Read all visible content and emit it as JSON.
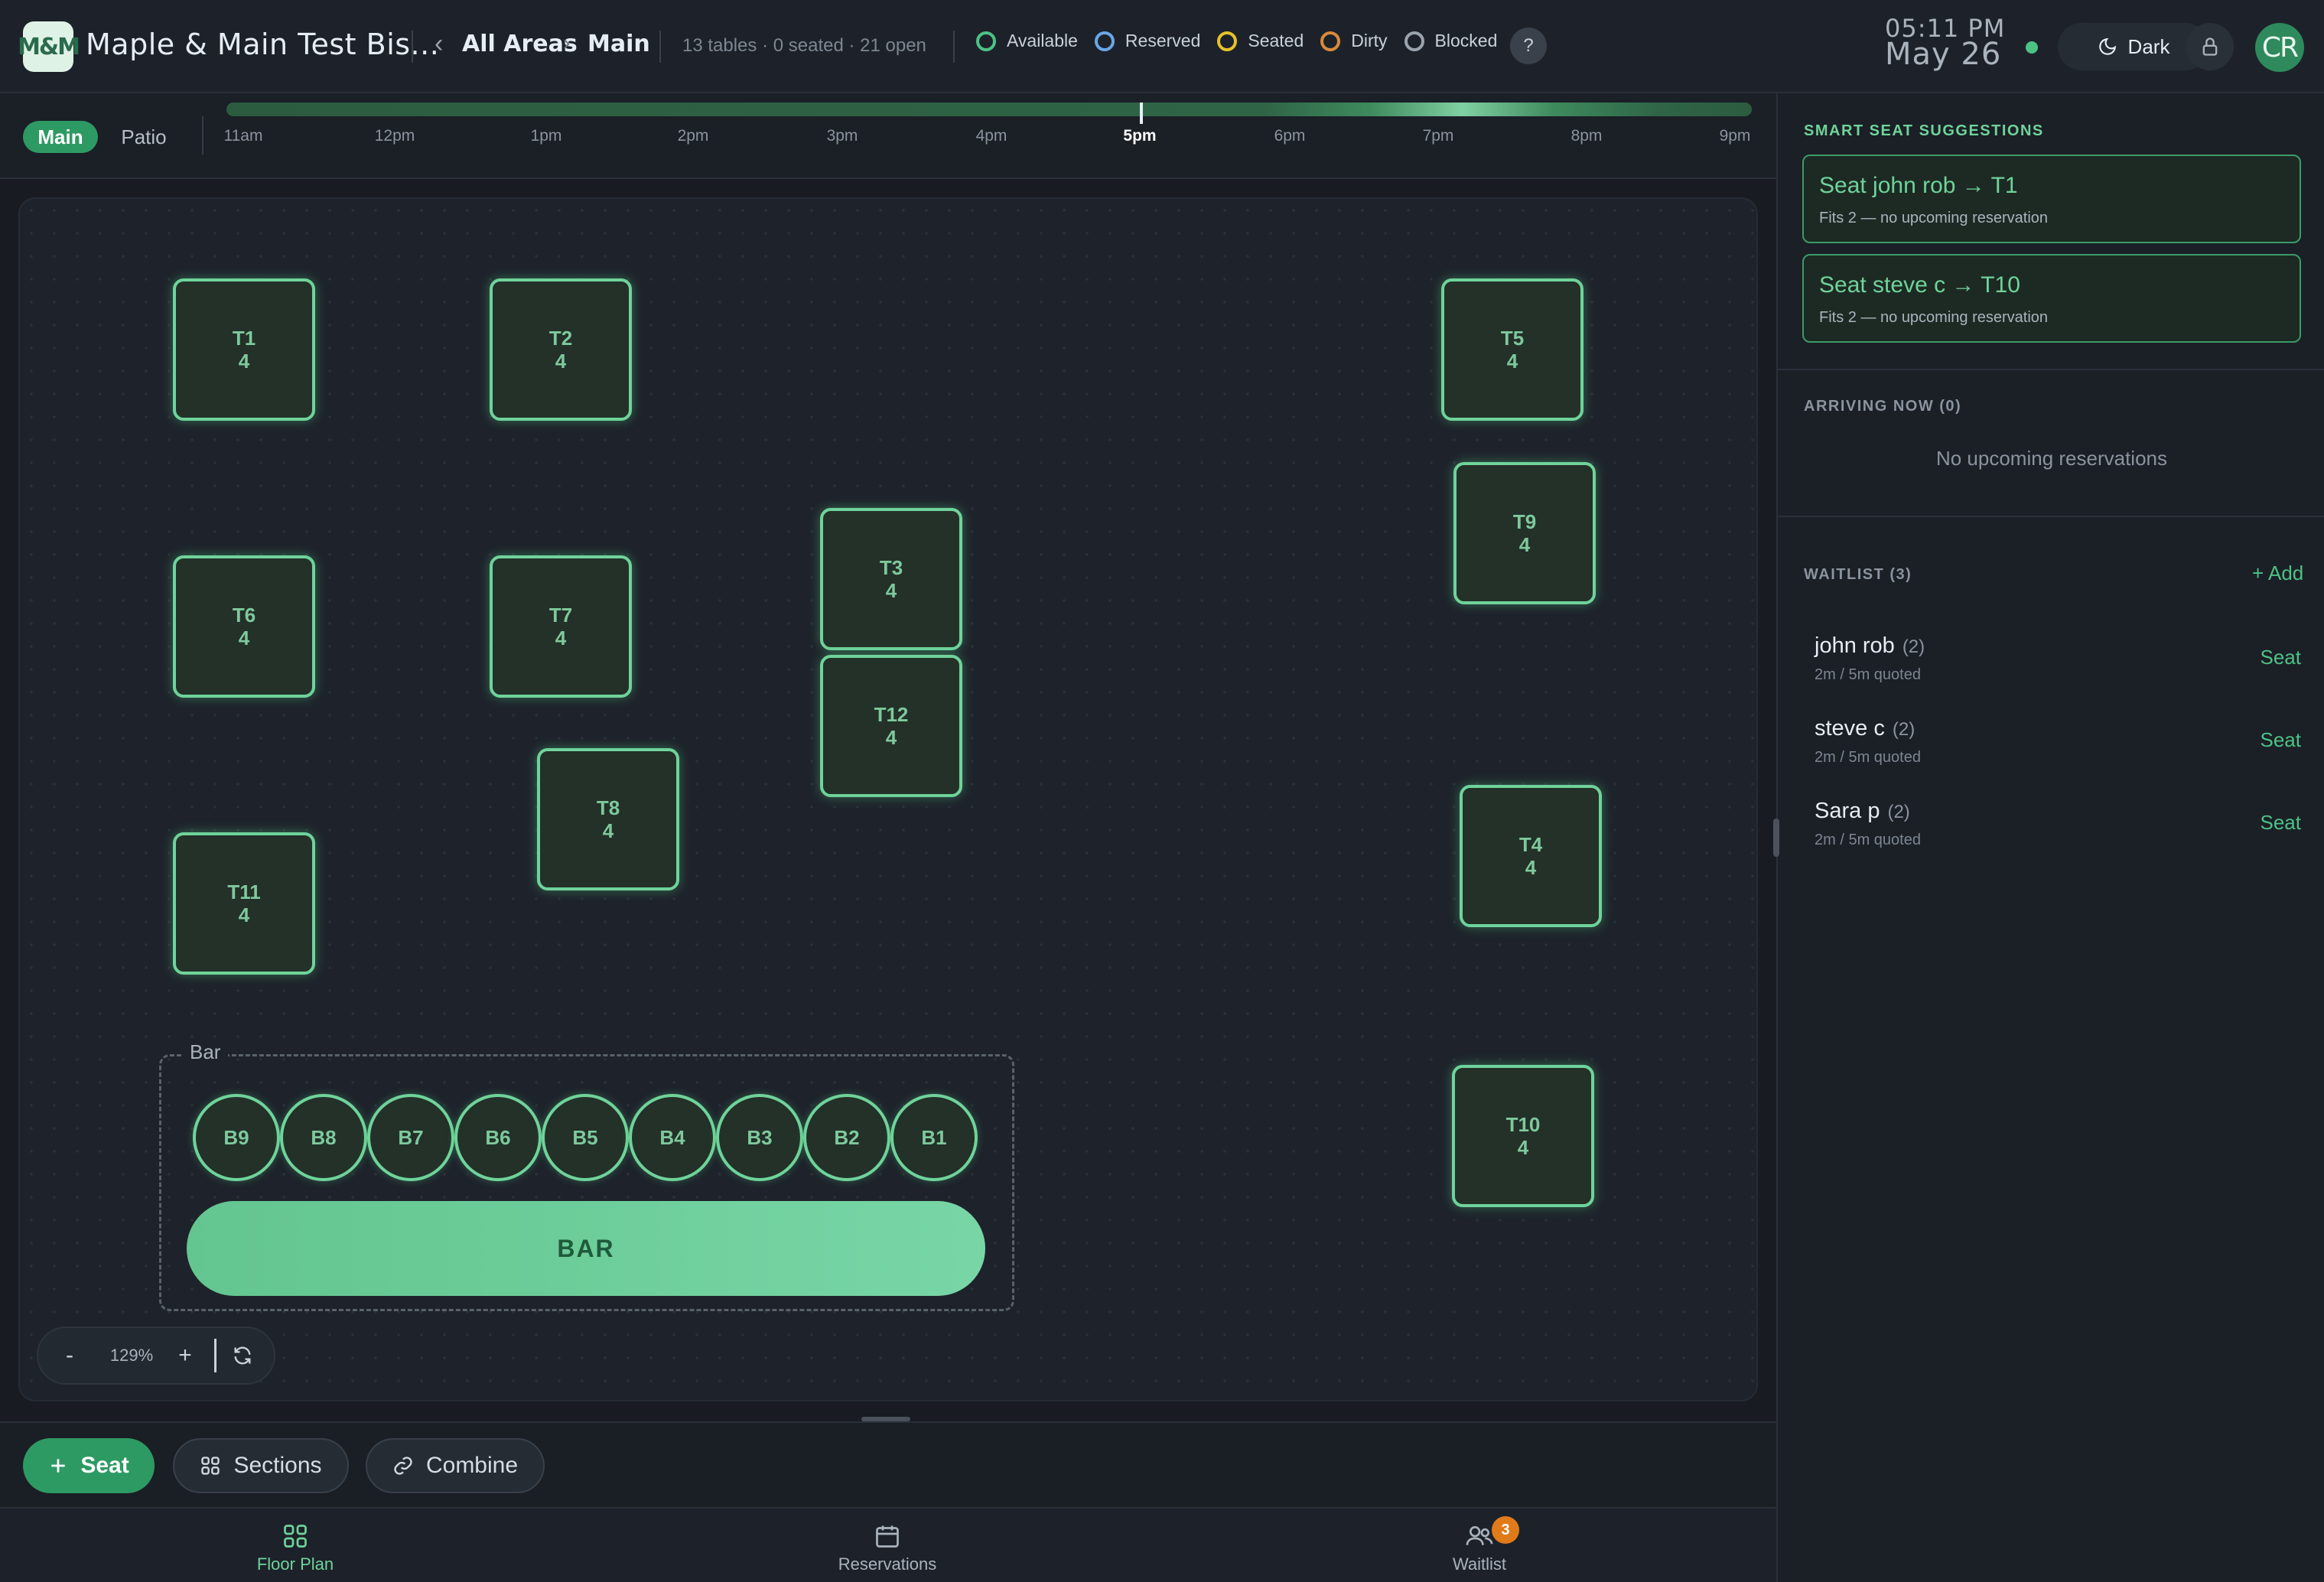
{
  "header": {
    "logo_text": "M&M",
    "venue_name": "Maple & Main Test Bis...",
    "breadcrumb_back": "‹",
    "breadcrumb_all": "All Areas",
    "breadcrumb_sep": "›",
    "breadcrumb_current": "Main",
    "stats": "13 tables · 0 seated · 21 open",
    "legend": [
      {
        "label": "Available",
        "color": "#4cc285"
      },
      {
        "label": "Reserved",
        "color": "#6aa6e6"
      },
      {
        "label": "Seated",
        "color": "#e6c229"
      },
      {
        "label": "Dirty",
        "color": "#d98a3a"
      },
      {
        "label": "Blocked",
        "color": "#9aa3ad"
      }
    ],
    "help_label": "?",
    "time": "05:11 PM",
    "date": "May 26",
    "theme_label": "Dark",
    "avatar_initials": "CR"
  },
  "areas": {
    "tabs": [
      {
        "label": "Main",
        "active": true
      },
      {
        "label": "Patio",
        "active": false
      }
    ]
  },
  "timeline": {
    "hours": [
      "11am",
      "12pm",
      "1pm",
      "2pm",
      "3pm",
      "4pm",
      "5pm",
      "6pm",
      "7pm",
      "8pm",
      "9pm"
    ],
    "current": "5pm"
  },
  "floor": {
    "tables": [
      {
        "name": "T1",
        "capacity": "4"
      },
      {
        "name": "T2",
        "capacity": "4"
      },
      {
        "name": "T5",
        "capacity": "4"
      },
      {
        "name": "T9",
        "capacity": "4"
      },
      {
        "name": "T6",
        "capacity": "4"
      },
      {
        "name": "T7",
        "capacity": "4"
      },
      {
        "name": "T3",
        "capacity": "4"
      },
      {
        "name": "T12",
        "capacity": "4"
      },
      {
        "name": "T8",
        "capacity": "4"
      },
      {
        "name": "T11",
        "capacity": "4"
      },
      {
        "name": "T4",
        "capacity": "4"
      },
      {
        "name": "T10",
        "capacity": "4"
      }
    ],
    "bar": {
      "zone_label": "Bar",
      "counter_label": "BAR",
      "seats": [
        "B9",
        "B8",
        "B7",
        "B6",
        "B5",
        "B4",
        "B3",
        "B2",
        "B1"
      ]
    },
    "zoom": {
      "minus": "-",
      "value": "129%",
      "plus": "+"
    }
  },
  "actions": {
    "seat": "Seat",
    "sections": "Sections",
    "combine": "Combine"
  },
  "nav": {
    "items": [
      {
        "label": "Floor Plan",
        "active": true
      },
      {
        "label": "Reservations",
        "active": false
      },
      {
        "label": "Waitlist",
        "active": false
      }
    ],
    "waitlist_badge": "3"
  },
  "panel": {
    "suggestions_title": "SMART SEAT SUGGESTIONS",
    "suggestions": [
      {
        "title": "Seat john rob → T1",
        "subtitle": "Fits 2 — no upcoming reservation"
      },
      {
        "title": "Seat steve c → T10",
        "subtitle": "Fits 2 — no upcoming reservation"
      }
    ],
    "arriving_title": "ARRIVING NOW (0)",
    "arriving_empty": "No upcoming reservations",
    "waitlist_title": "WAITLIST (3)",
    "waitlist_add": "+ Add",
    "waitlist": [
      {
        "name": "john rob",
        "party": "(2)",
        "meta": "2m / 5m quoted",
        "action": "Seat"
      },
      {
        "name": "steve c",
        "party": "(2)",
        "meta": "2m / 5m quoted",
        "action": "Seat"
      },
      {
        "name": "Sara p",
        "party": "(2)",
        "meta": "2m / 5m quoted",
        "action": "Seat"
      }
    ]
  }
}
